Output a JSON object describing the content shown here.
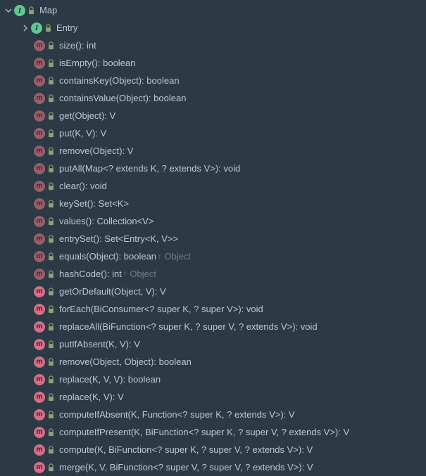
{
  "root": {
    "name": "Map",
    "iconLetter": "I",
    "chevron": "down"
  },
  "child": {
    "name": "Entry",
    "iconLetter": "I",
    "chevron": "right"
  },
  "methods": [
    {
      "sig": "size(): int",
      "style": "dim",
      "override": null
    },
    {
      "sig": "isEmpty(): boolean",
      "style": "dim",
      "override": null
    },
    {
      "sig": "containsKey(Object): boolean",
      "style": "dim",
      "override": null
    },
    {
      "sig": "containsValue(Object): boolean",
      "style": "dim",
      "override": null
    },
    {
      "sig": "get(Object): V",
      "style": "dim",
      "override": null
    },
    {
      "sig": "put(K, V): V",
      "style": "dim",
      "override": null
    },
    {
      "sig": "remove(Object): V",
      "style": "dim",
      "override": null
    },
    {
      "sig": "putAll(Map<? extends K, ? extends V>): void",
      "style": "dim",
      "override": null
    },
    {
      "sig": "clear(): void",
      "style": "dim",
      "override": null
    },
    {
      "sig": "keySet(): Set<K>",
      "style": "dim",
      "override": null
    },
    {
      "sig": "values(): Collection<V>",
      "style": "dim",
      "override": null
    },
    {
      "sig": "entrySet(): Set<Entry<K, V>>",
      "style": "dim",
      "override": null
    },
    {
      "sig": "equals(Object): boolean",
      "style": "dim",
      "override": "Object"
    },
    {
      "sig": "hashCode(): int",
      "style": "dim",
      "override": "Object"
    },
    {
      "sig": "getOrDefault(Object, V): V",
      "style": "bri",
      "override": null
    },
    {
      "sig": "forEach(BiConsumer<? super K, ? super V>): void",
      "style": "bri",
      "override": null
    },
    {
      "sig": "replaceAll(BiFunction<? super K, ? super V, ? extends V>): void",
      "style": "bri",
      "override": null
    },
    {
      "sig": "putIfAbsent(K, V): V",
      "style": "bri",
      "override": null
    },
    {
      "sig": "remove(Object, Object): boolean",
      "style": "bri",
      "override": null
    },
    {
      "sig": "replace(K, V, V): boolean",
      "style": "bri",
      "override": null
    },
    {
      "sig": "replace(K, V): V",
      "style": "bri",
      "override": null
    },
    {
      "sig": "computeIfAbsent(K, Function<? super K, ? extends V>): V",
      "style": "bri",
      "override": null
    },
    {
      "sig": "computeIfPresent(K, BiFunction<? super K, ? super V, ? extends V>): V",
      "style": "bri",
      "override": null
    },
    {
      "sig": "compute(K, BiFunction<? super K, ? super V, ? extends V>): V",
      "style": "bri",
      "override": null
    },
    {
      "sig": "merge(K, V, BiFunction<? super V, ? super V, ? extends V>): V",
      "style": "bri",
      "override": null
    }
  ],
  "iconGlyphs": {
    "methodLetter": "m"
  },
  "colors": {
    "lock": "#8aa56f",
    "chev": "#aab6bf"
  }
}
